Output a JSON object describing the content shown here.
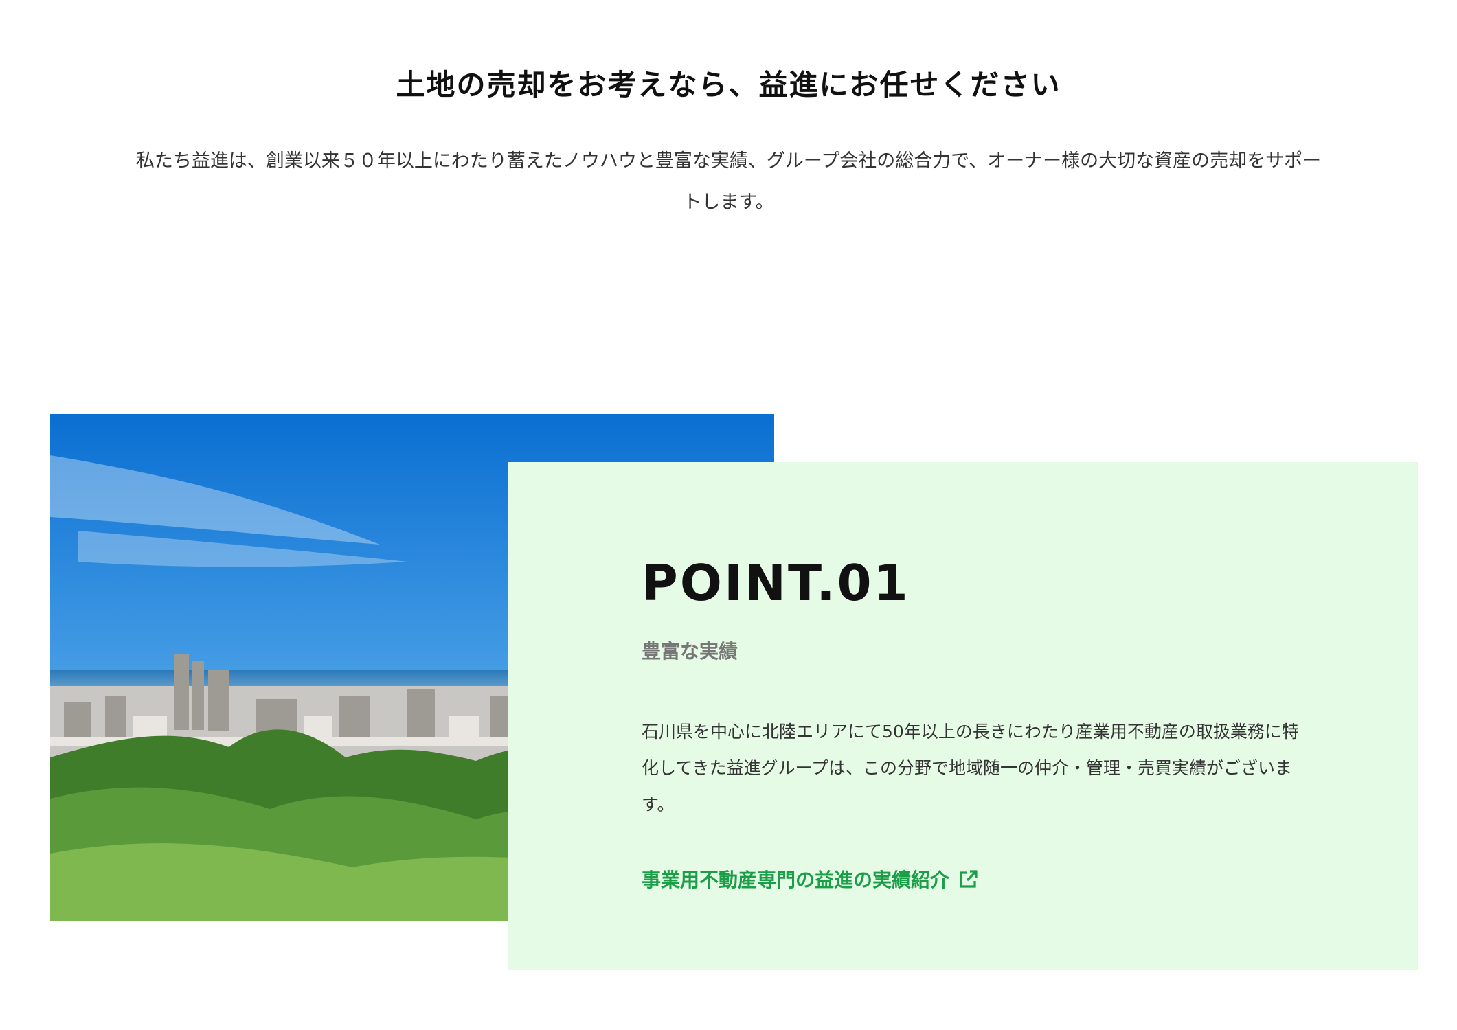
{
  "header": {
    "title": "土地の売却をお考えなら、益進にお任せください",
    "intro": "私たち益進は、創業以来５０年以上にわたり蓄えたノウハウと豊富な実績、グループ会社の総合力で、オーナー様の大切な資産の売却をサポートします。"
  },
  "point": {
    "heading": "POINT.01",
    "subtitle": "豊富な実績",
    "body": "石川県を中心に北陸エリアにて50年以上の長きにわたり産業用不動産の取扱業務に特化してきた益進グループは、この分野で地域随一の仲介・管理・売買実績がございます。",
    "link_label": "事業用不動産専門の益進の実績紹介",
    "link_icon": "external-link-icon"
  },
  "colors": {
    "card_background": "#e6fbe6",
    "link": "#1a9e47",
    "sky": "#1f7fd8",
    "greenery": "#3f7d2a"
  }
}
